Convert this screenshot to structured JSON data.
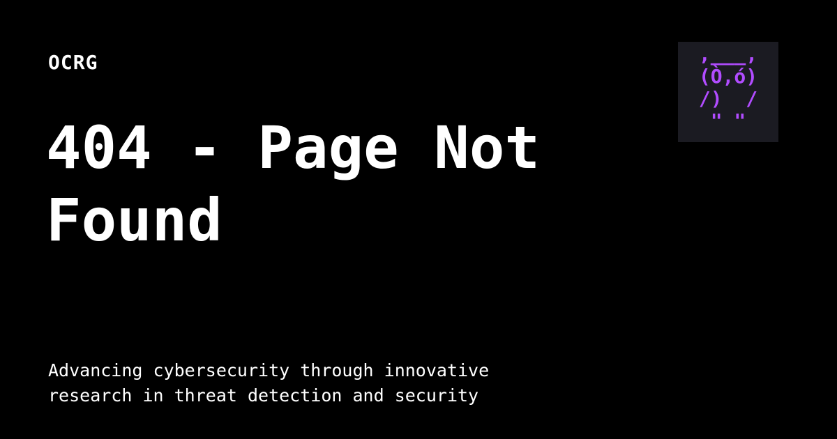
{
  "header": {
    "brand": "OCRG"
  },
  "main": {
    "title": "404 - Page Not Found",
    "tagline_line1": "Advancing cybersecurity through innovative",
    "tagline_line2": "research in threat detection and security"
  },
  "logo": {
    "icon": "owl-ascii-art-icon",
    "art_lines": [
      ",___,",
      "(Ò,ó)",
      "/)  /",
      "\" \""
    ],
    "color": "#b14cff",
    "background": "#1b1b22"
  },
  "colors": {
    "background": "#000000",
    "text": "#ffffff",
    "accent": "#b14cff"
  }
}
